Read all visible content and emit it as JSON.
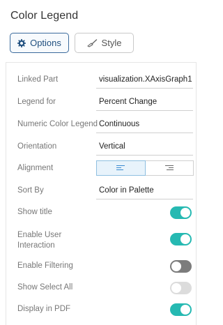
{
  "panel": {
    "title": "Color Legend"
  },
  "tabs": {
    "options_label": "Options",
    "style_label": "Style"
  },
  "fields": {
    "linked_part": {
      "label": "Linked Part",
      "value": "visualization.XAxisGraph1"
    },
    "legend_for": {
      "label": "Legend for",
      "value": "Percent Change"
    },
    "numeric_color_legend": {
      "label": "Numeric Color Legend",
      "value": "Continuous"
    },
    "orientation": {
      "label": "Orientation",
      "value": "Vertical"
    },
    "alignment": {
      "label": "Alignment",
      "selected": "left"
    },
    "sort_by": {
      "label": "Sort By",
      "value": "Color in Palette"
    }
  },
  "toggles": {
    "show_title": {
      "label": "Show title",
      "on": true
    },
    "enable_user_interaction": {
      "label_line1": "Enable User",
      "label_line2": "Interaction",
      "on": true
    },
    "enable_filtering": {
      "label": "Enable Filtering",
      "on": false
    },
    "show_select_all": {
      "label": "Show Select All",
      "on": false,
      "disabled": true
    },
    "display_in_pdf": {
      "label": "Display in PDF",
      "on": true
    }
  },
  "colors": {
    "accent": "#26b9b2",
    "tab_active_border": "#3a6a9c",
    "align_active": "#3a8ad0"
  }
}
